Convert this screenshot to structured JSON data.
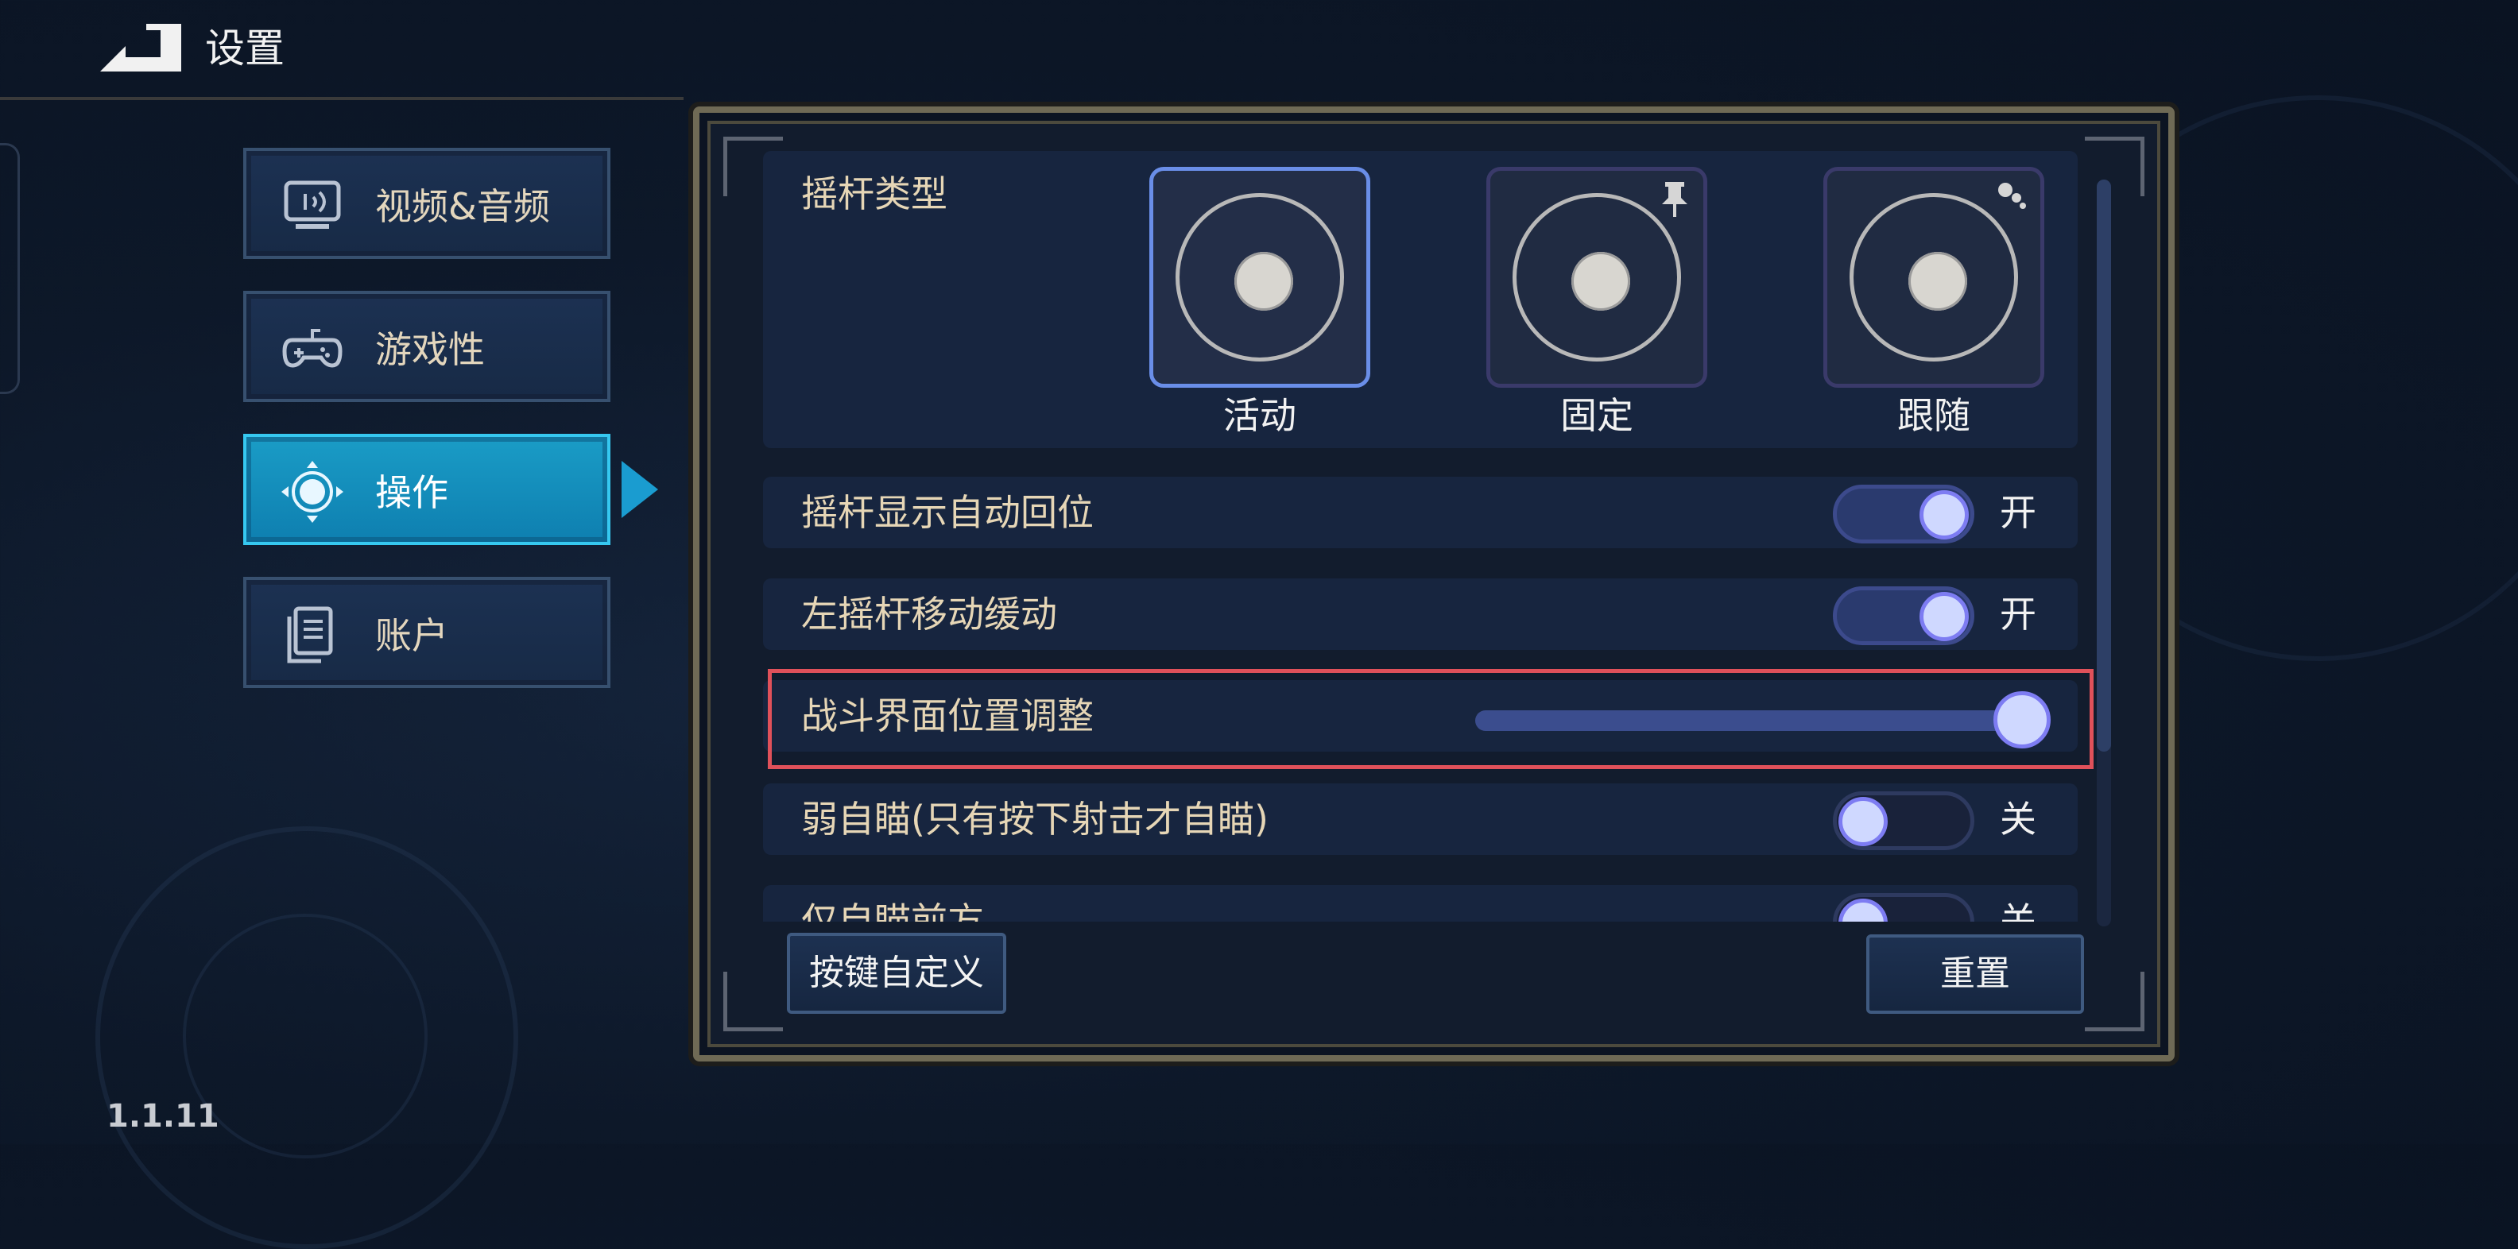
{
  "header": {
    "title": "设置",
    "back_icon": "back-arrow-icon"
  },
  "sidebar": {
    "items": [
      {
        "label": "视频&音频",
        "icon": "monitor-sound-icon",
        "active": false
      },
      {
        "label": "游戏性",
        "icon": "gamepad-icon",
        "active": false
      },
      {
        "label": "操作",
        "icon": "dpad-icon",
        "active": true
      },
      {
        "label": "账户",
        "icon": "document-icon",
        "active": false
      }
    ]
  },
  "version": "1.1.11",
  "settings": {
    "joystick_type": {
      "label": "摇杆类型",
      "options": [
        {
          "label": "活动",
          "selected": true
        },
        {
          "label": "固定",
          "selected": false,
          "badge": "pin-icon"
        },
        {
          "label": "跟随",
          "selected": false,
          "badge": "dots-icon"
        }
      ]
    },
    "rows": [
      {
        "label": "摇杆显示自动回位",
        "state": "开"
      },
      {
        "label": "左摇杆移动缓动",
        "state": "开"
      },
      {
        "label": "战斗界面位置调整",
        "slider_value": 1.0
      },
      {
        "label": "弱自瞄(只有按下射击才自瞄)",
        "state": "关"
      },
      {
        "label": "仅自瞄前方",
        "state": "关"
      }
    ]
  },
  "buttons": {
    "custom_keys": "按键自定义",
    "reset": "重置"
  },
  "colors": {
    "accent": "#1a9cc6",
    "toggle_thumb": "#cfd8ff",
    "highlight": "#e0515a",
    "label": "#e6d6b6"
  }
}
